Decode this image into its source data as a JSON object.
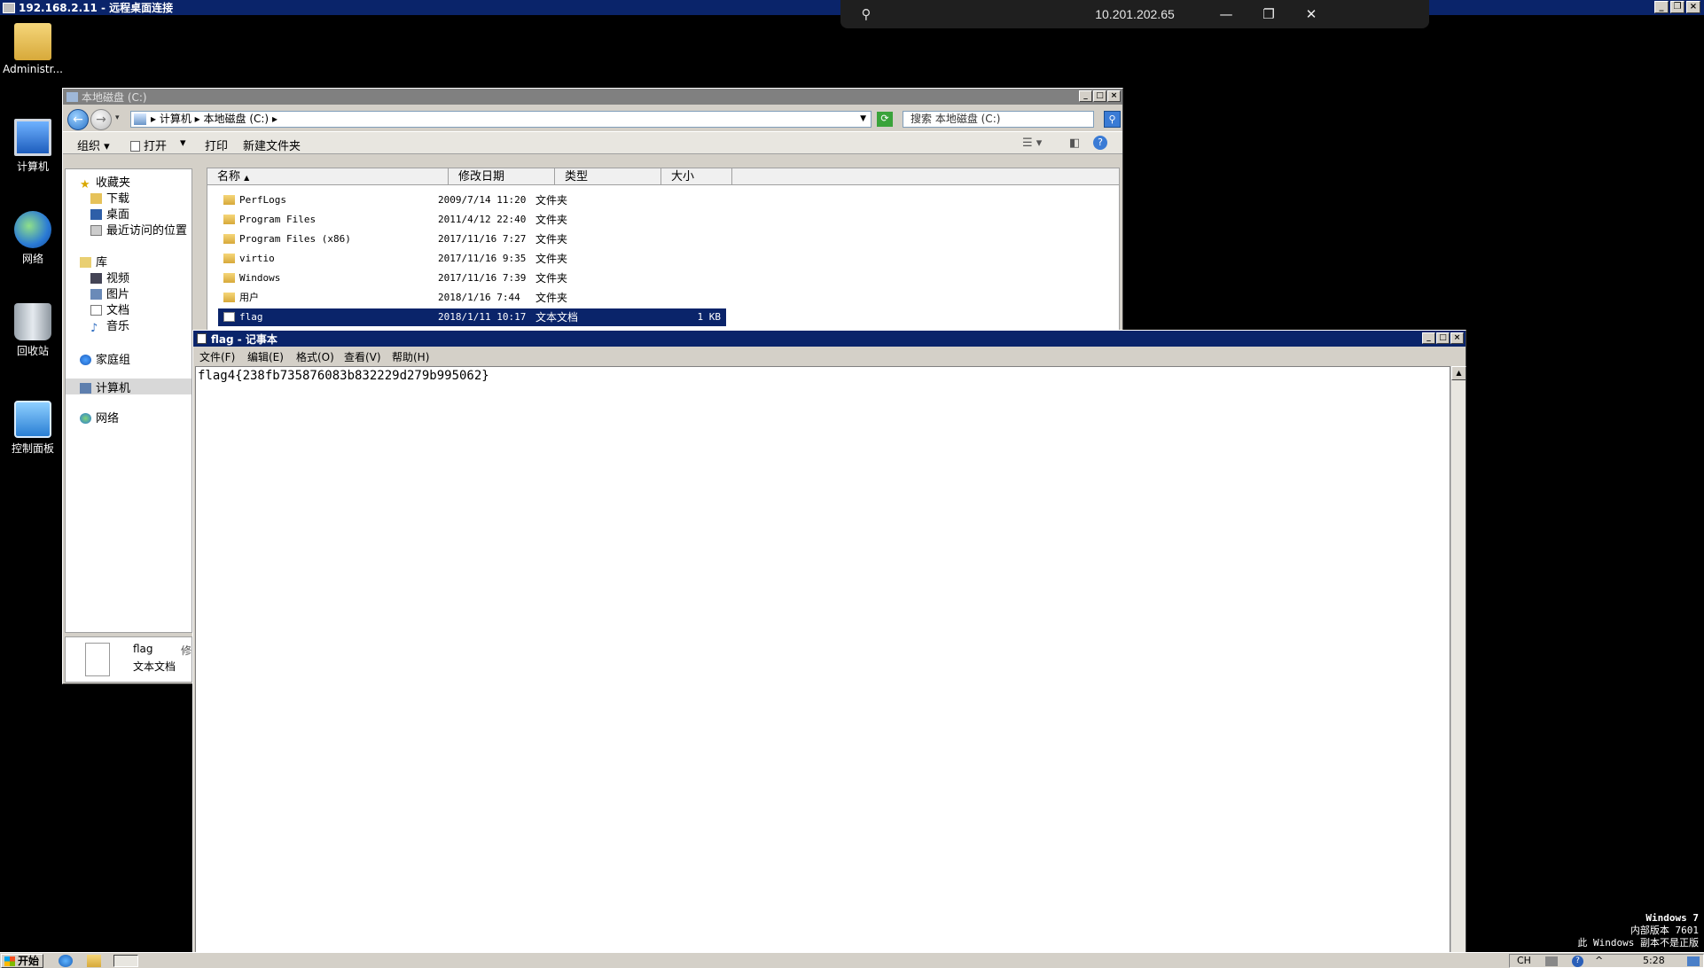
{
  "rdp": {
    "title": "192.168.2.11 - 远程桌面连接"
  },
  "conn_bar": {
    "ip": "10.201.202.65"
  },
  "desktop": {
    "icons": [
      {
        "label": "Administr..."
      },
      {
        "label": "计算机"
      },
      {
        "label": "网络"
      },
      {
        "label": "回收站"
      },
      {
        "label": "控制面板"
      }
    ]
  },
  "explorer": {
    "title": "本地磁盘 (C:)",
    "address": {
      "part1": "计算机",
      "part2": "本地磁盘 (C:)"
    },
    "search_placeholder": "搜索 本地磁盘 (C:)",
    "toolbar": {
      "organize": "组织",
      "open": "打开",
      "print": "打印",
      "new_folder": "新建文件夹"
    },
    "nav": {
      "favorites": "收藏夹",
      "downloads": "下载",
      "desktop": "桌面",
      "recent": "最近访问的位置",
      "libraries": "库",
      "videos": "视频",
      "pictures": "图片",
      "documents": "文档",
      "music": "音乐",
      "homegroup": "家庭组",
      "computer": "计算机",
      "network": "网络"
    },
    "columns": {
      "name": "名称",
      "modified": "修改日期",
      "type": "类型",
      "size": "大小"
    },
    "rows": [
      {
        "name": "PerfLogs",
        "modified": "2009/7/14 11:20",
        "type": "文件夹",
        "size": ""
      },
      {
        "name": "Program Files",
        "modified": "2011/4/12 22:40",
        "type": "文件夹",
        "size": ""
      },
      {
        "name": "Program Files (x86)",
        "modified": "2017/11/16 7:27",
        "type": "文件夹",
        "size": ""
      },
      {
        "name": "virtio",
        "modified": "2017/11/16 9:35",
        "type": "文件夹",
        "size": ""
      },
      {
        "name": "Windows",
        "modified": "2017/11/16 7:39",
        "type": "文件夹",
        "size": ""
      },
      {
        "name": "用户",
        "modified": "2018/1/16 7:44",
        "type": "文件夹",
        "size": ""
      },
      {
        "name": "flag",
        "modified": "2018/1/11 10:17",
        "type": "文本文档",
        "size": "1 KB"
      }
    ],
    "details": {
      "name": "flag",
      "type": "文本文档",
      "extra": "修"
    }
  },
  "notepad": {
    "title": "flag - 记事本",
    "menu": {
      "file": "文件(F)",
      "edit": "编辑(E)",
      "format": "格式(O)",
      "view": "查看(V)",
      "help": "帮助(H)"
    },
    "content": "flag4{238fb735876083b832229d279b995062}"
  },
  "watermark": {
    "line1": "Windows 7",
    "line2": "内部版本 7601",
    "line3": "此 Windows 副本不是正版"
  },
  "taskbar": {
    "start": "开始",
    "lang": "CH",
    "clock": "5:28"
  }
}
